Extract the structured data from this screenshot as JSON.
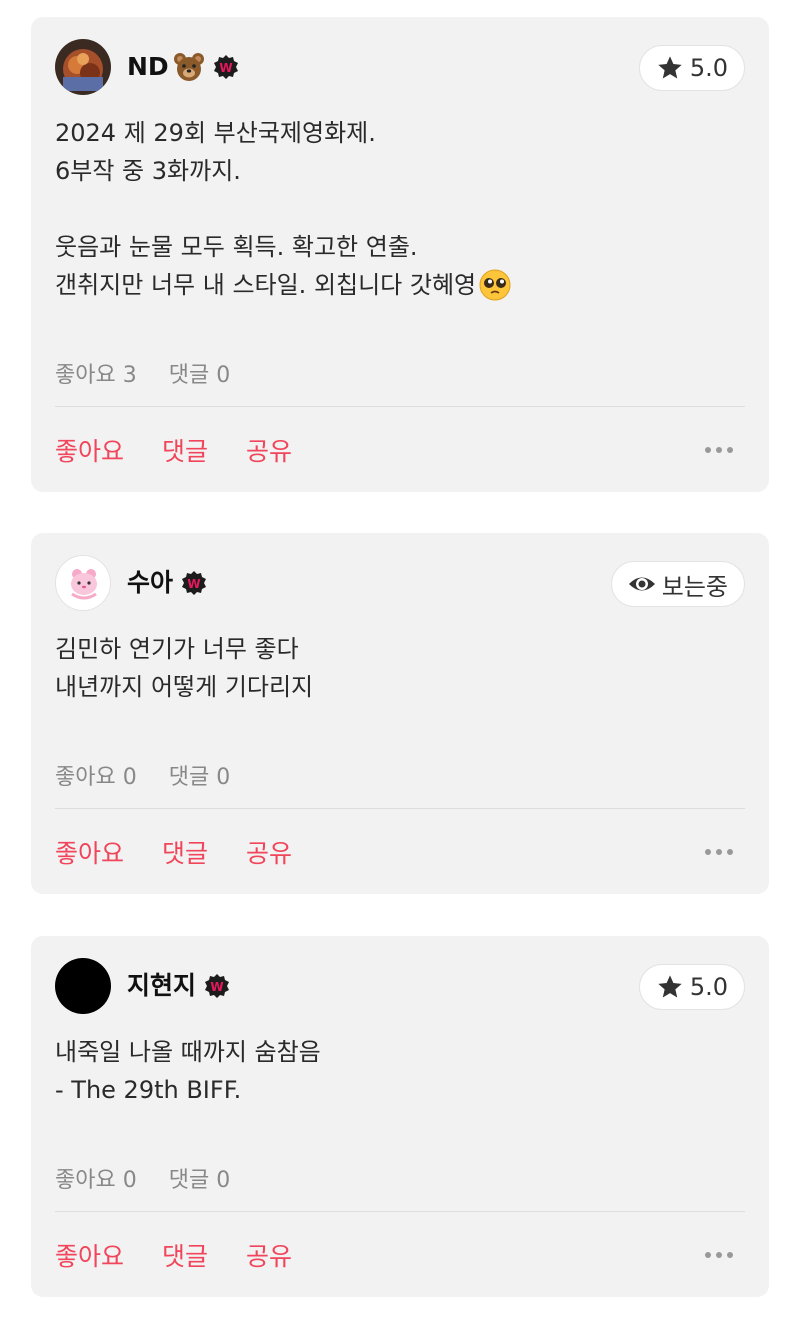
{
  "reviews": [
    {
      "user": {
        "name": "ND",
        "avatar": "photo-avatar",
        "name_emoji": "bear-emoji",
        "badge": "w-badge"
      },
      "pill": {
        "type": "rating",
        "icon": "star-icon",
        "value": "5.0"
      },
      "lines": [
        "2024 제 29회 부산국제영화제.",
        "6부작 중 3화까지.",
        "",
        "웃음과 눈물 모두 획득. 확고한 연출.",
        "갠취지만 너무 내 스타일. 외칩니다 갓혜영"
      ],
      "trailing_emoji": "pleading-face-emoji",
      "stats": {
        "likes": "좋아요 3",
        "comments": "댓글 0"
      },
      "actions": {
        "like": "좋아요",
        "comment": "댓글",
        "share": "공유"
      }
    },
    {
      "user": {
        "name": "수아",
        "avatar": "pink-character-avatar",
        "badge": "w-badge"
      },
      "pill": {
        "type": "status",
        "icon": "eye-icon",
        "value": "보는중"
      },
      "lines": [
        "김민하 연기가 너무 좋다",
        "내년까지 어떻게 기다리지"
      ],
      "stats": {
        "likes": "좋아요 0",
        "comments": "댓글 0"
      },
      "actions": {
        "like": "좋아요",
        "comment": "댓글",
        "share": "공유"
      }
    },
    {
      "user": {
        "name": "지현지",
        "avatar": "black-avatar",
        "badge": "w-badge"
      },
      "pill": {
        "type": "rating",
        "icon": "star-icon",
        "value": "5.0"
      },
      "lines": [
        "내죽일 나올 때까지 숨참음",
        "- The 29th BIFF."
      ],
      "stats": {
        "likes": "좋아요 0",
        "comments": "댓글 0"
      },
      "actions": {
        "like": "좋아요",
        "comment": "댓글",
        "share": "공유"
      }
    }
  ],
  "colors": {
    "accent": "#f0455a",
    "card_bg": "#f2f2f2",
    "badge": "#e8175d"
  }
}
